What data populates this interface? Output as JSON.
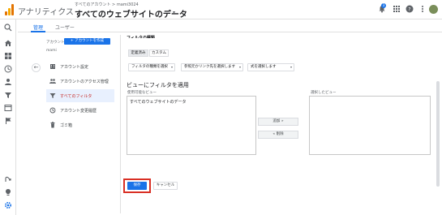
{
  "header": {
    "app_title": "アナリティクス",
    "breadcrumb": "すべてのアカウント > mami3024",
    "view_title": "すべてのウェブサイトのデータ",
    "view_caret": "▾",
    "notification_count": "3",
    "icons": [
      "bell-icon",
      "apps-icon",
      "help-icon",
      "more-vert-icon",
      "avatar"
    ]
  },
  "tabs": {
    "admin": "管理",
    "user": "ユーザー"
  },
  "account": {
    "label": "アカウント",
    "create_button": "+ アカウントを作成",
    "name": "mami",
    "menu": [
      {
        "label": "アカウント設定",
        "icon": "building-icon"
      },
      {
        "label": "アカウントのアクセス管理",
        "icon": "people-icon"
      },
      {
        "label": "すべてのフィルタ",
        "icon": "filter-icon",
        "active": true
      },
      {
        "label": "アカウント変更履歴",
        "icon": "history-icon"
      },
      {
        "label": "ゴミ箱",
        "icon": "trash-icon"
      }
    ]
  },
  "filter_form": {
    "cut_heading": "フィルタの種類",
    "type_buttons": [
      "定義済み",
      "カスタム"
    ],
    "selects": [
      "フィルタの種類を選択",
      "参照元かリンク先を選択します",
      "式を選択します"
    ],
    "apply_title": "ビューにフィルタを適用",
    "available_label": "使用可能なビュー",
    "selected_label": "選択したビュー",
    "available_items": [
      "すべてのウェブサイトのデータ"
    ],
    "add_button": "追加 »",
    "remove_button": "« 削除",
    "save_button": "保存",
    "cancel_button": "キャンセル"
  },
  "colors": {
    "accent": "#1a73e8",
    "highlight": "#d93025",
    "active_item": "#c5221f"
  }
}
